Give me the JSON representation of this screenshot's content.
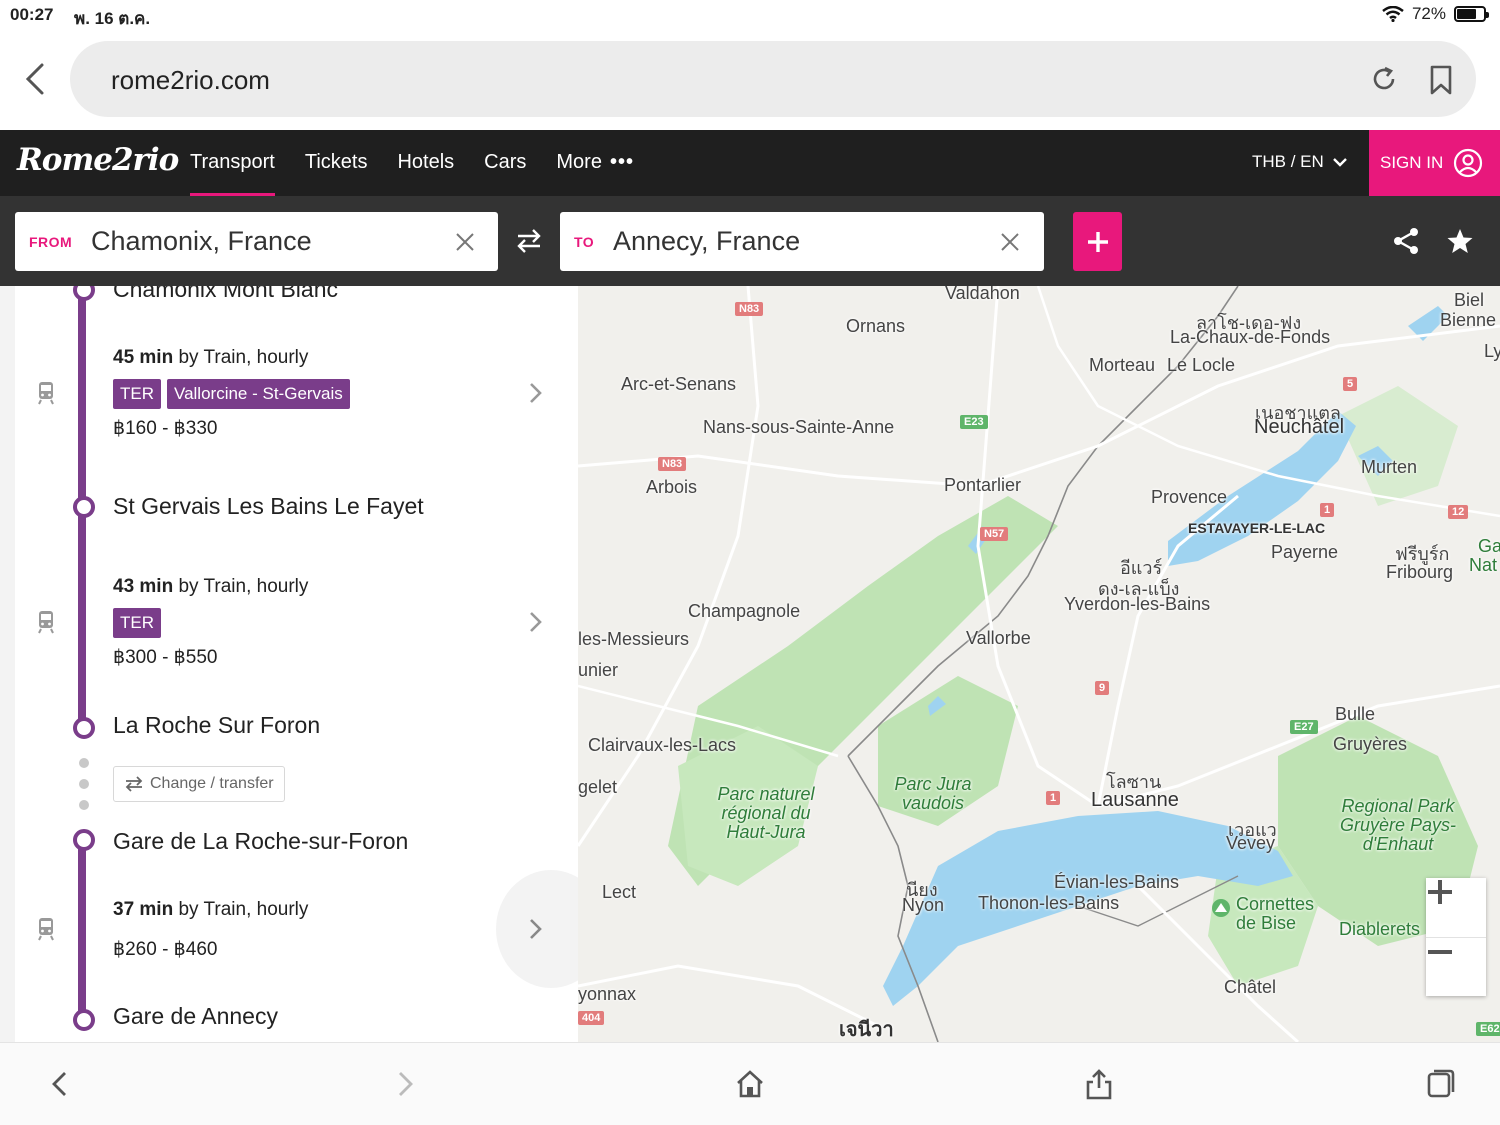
{
  "status": {
    "time": "00:27",
    "date": "พ. 16 ต.ค.",
    "battery": "72%",
    "battery_level": 0.72
  },
  "browser": {
    "url": "rome2rio.com"
  },
  "nav": {
    "logo": "Rome2rio",
    "items": [
      {
        "label": "Transport",
        "active": true
      },
      {
        "label": "Tickets"
      },
      {
        "label": "Hotels"
      },
      {
        "label": "Cars"
      },
      {
        "label": "More"
      }
    ],
    "currency": "THB / EN",
    "signin": "SIGN IN"
  },
  "search": {
    "from_label": "FROM",
    "from_value": "Chamonix, France",
    "to_label": "TO",
    "to_value": "Annecy, France"
  },
  "route": {
    "stops": [
      "Chamonix Mont Blanc",
      "St Gervais Les Bains Le Fayet",
      "La Roche Sur Foron",
      "Gare de La Roche-sur-Foron",
      "Gare de Annecy"
    ],
    "segments": [
      {
        "duration": "45 min",
        "detail": " by Train, hourly",
        "tags": [
          "TER",
          "Vallorcine - St-Gervais"
        ],
        "price": "฿160 - ฿330"
      },
      {
        "duration": "43 min",
        "detail": " by Train, hourly",
        "tags": [
          "TER"
        ],
        "price": "฿300 - ฿550"
      },
      {
        "duration": "37 min",
        "detail": " by Train, hourly",
        "tags": [],
        "price": "฿260 - ฿460"
      }
    ],
    "change_label": "Change / transfer"
  },
  "map": {
    "labels": [
      "Valdahon",
      "Ornans",
      "Arc-et-Senans",
      "Nans-sous-Sainte-Anne",
      "Arbois",
      "Pontarlier",
      "ลาโช-เดอ-ฟง",
      "La-Chaux-de-Fonds",
      "Morteau",
      "Le Locle",
      "เนอชาแตล",
      "Neuchâtel",
      "Murten",
      "Provence",
      "ESTAVAYER-LE-LAC",
      "Payerne",
      "อีแวร์",
      "ดง-เล-แบ็ง",
      "Yverdon-les-Bains",
      "ฟรีบูร์ก",
      "Fribourg",
      "Champagnole",
      "les-Messieurs",
      "unier",
      "Vallorbe",
      "Clairvaux-les-Lacs",
      "Bulle",
      "Gruyères",
      "gelet",
      "โลซาน",
      "Lausanne",
      "Parc naturel régional du Haut-Jura",
      "Parc Jura vaudois",
      "Regional Park Gruyère Pays-d'Enhaut",
      "เวอแว",
      "Vevey",
      "Lect",
      "Évian-les-Bains",
      "นียง",
      "Nyon",
      "Thonon-les-Bains",
      "Cornettes de Bise",
      "Diablerets",
      "yonnax",
      "Châtel",
      "เจนีวา",
      "Biel",
      "Bienne",
      "Ly",
      "Ga",
      "Nat"
    ],
    "roads": [
      "N83",
      "E23",
      "N83",
      "N57",
      "5",
      "1",
      "12",
      "9",
      "E27",
      "1",
      "404",
      "E62"
    ]
  },
  "colors": {
    "accent": "#e8187c",
    "route": "#7a3d8a",
    "navbar": "#1f1f1f",
    "searchbar": "#333333",
    "water": "#9fd3f0",
    "park": "#bfe3b4"
  },
  "icons": [
    "back-chevron-icon",
    "reload-icon",
    "bookmark-icon",
    "chevron-down-icon",
    "user-icon",
    "clear-icon",
    "swap-icon",
    "plus-icon",
    "share-icon",
    "star-icon",
    "train-icon",
    "chevron-right-icon",
    "transfer-icon",
    "zoom-in-icon",
    "zoom-out-icon",
    "home-icon",
    "tabs-icon"
  ]
}
